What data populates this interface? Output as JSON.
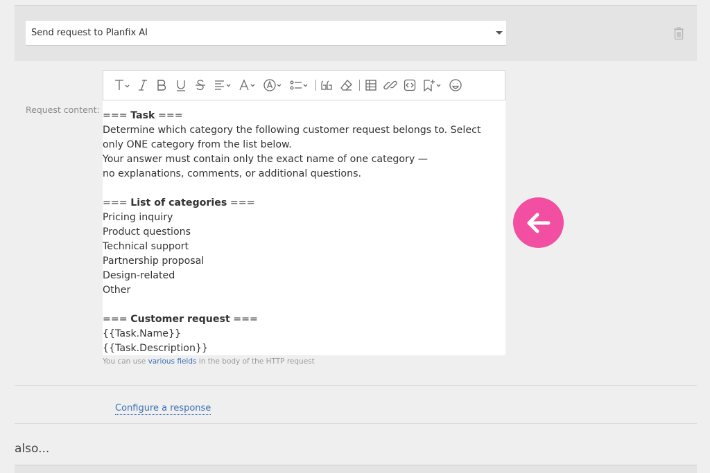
{
  "action": {
    "selected": "Send request to Planfix AI",
    "delete_icon": "trash-icon"
  },
  "request": {
    "label": "Request content:",
    "toolbar_icons": [
      "text-style-icon",
      "italic-icon",
      "bold-icon",
      "underline-icon",
      "strikethrough-icon",
      "align-icon",
      "font-color-icon",
      "highlight-icon",
      "list-icon",
      "quote-icon",
      "clear-format-icon",
      "table-icon",
      "link-icon",
      "code-icon",
      "insert-field-icon",
      "emoji-icon"
    ],
    "lines": [
      {
        "prefix": "=== ",
        "bold": "Task",
        "suffix": " ==="
      },
      {
        "text": "Determine which category the following customer request belongs to. Select"
      },
      {
        "text": "only ONE category from the list below."
      },
      {
        "text": "Your answer must contain only the exact name of one category —"
      },
      {
        "text": "no explanations, comments, or additional questions."
      },
      {
        "text": ""
      },
      {
        "prefix": "=== ",
        "bold": "List of categories",
        "suffix": " ==="
      },
      {
        "text": "Pricing inquiry"
      },
      {
        "text": "Product questions"
      },
      {
        "text": "Technical support"
      },
      {
        "text": "Partnership proposal"
      },
      {
        "text": "Design-related"
      },
      {
        "text": "Other"
      },
      {
        "text": ""
      },
      {
        "prefix": "=== ",
        "bold": "Customer request",
        "suffix": " ==="
      },
      {
        "text": "{{Task.Name}}"
      },
      {
        "text": "{{Task.Description}}"
      }
    ],
    "hint_before": "You can use ",
    "hint_link": "various fields",
    "hint_after": " in the body of the HTTP request"
  },
  "configure_link": "Configure a response",
  "also_label": "also...",
  "colors": {
    "accent": "#f24fa3",
    "link": "#3b6fb6"
  },
  "arrow_icon": "arrow-left-icon"
}
